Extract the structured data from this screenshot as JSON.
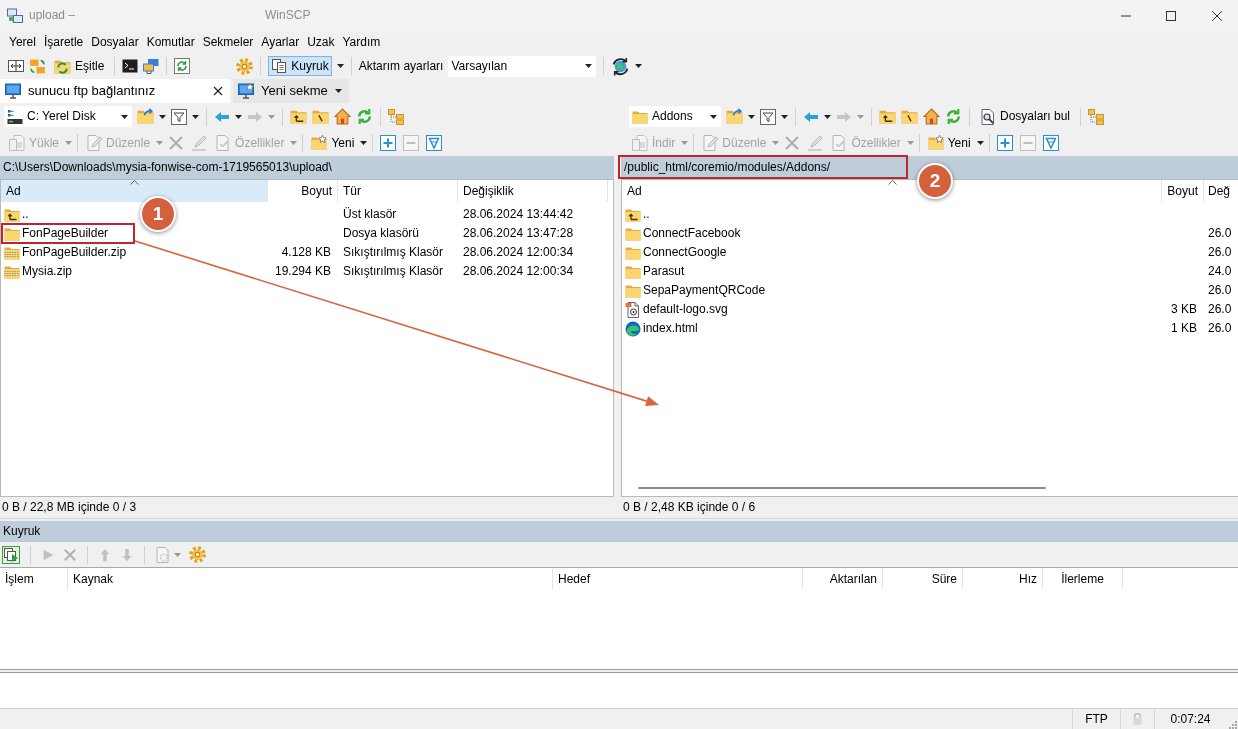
{
  "window": {
    "title": "upload –",
    "app_name": "WinSCP"
  },
  "menu": [
    "Yerel",
    "İşaretle",
    "Dosyalar",
    "Komutlar",
    "Sekmeler",
    "Ayarlar",
    "Uzak",
    "Yardım"
  ],
  "toolbar": {
    "sync_label": "Eşitle",
    "queue_button": {
      "label": "Kuyruk",
      "on": true
    },
    "transfer_settings_label": "Aktarım ayarları",
    "transfer_preset": "Varsayılan"
  },
  "tabs": [
    {
      "kind": "session",
      "label": "sunucu ftp bağlantınız",
      "selected": true
    },
    {
      "kind": "new",
      "label": "Yeni sekme",
      "selected": false
    }
  ],
  "local_panel": {
    "active": true,
    "location": {
      "kind": "drive",
      "label": "C: Yerel Disk"
    },
    "back_disabled": false,
    "forward_disabled": true,
    "commands": [
      {
        "kind": "transfer",
        "label": "Yükle",
        "disabled": true
      },
      {
        "kind": "edit",
        "label": "Düzenle",
        "disabled": true
      },
      {
        "kind": "delete",
        "disabled": true
      },
      {
        "kind": "rename",
        "disabled": true
      },
      {
        "kind": "properties",
        "label": "Özellikler",
        "disabled": true
      },
      {
        "kind": "new",
        "label": "Yeni",
        "disabled": false
      },
      {
        "kind": "select",
        "disabled": false
      },
      {
        "kind": "unselect",
        "disabled": true
      },
      {
        "kind": "filter",
        "disabled": false
      }
    ],
    "path": "C:\\Users\\Downloads\\mysia-fonwise-com-1719565013\\upload\\",
    "columns": [
      {
        "kind": "name",
        "label": "Ad",
        "sorted": true
      },
      {
        "kind": "size",
        "label": "Boyut",
        "sorted": false
      },
      {
        "kind": "type",
        "label": "Tür",
        "sorted": false
      },
      {
        "kind": "modified",
        "label": "Değişiklik",
        "sorted": false
      }
    ],
    "rows": [
      {
        "kind": "parent",
        "name": "..",
        "type": "Üst klasör",
        "modified": "28.06.2024 13:44:42"
      },
      {
        "kind": "folder",
        "name": "FonPageBuilder",
        "type": "Dosya klasörü",
        "modified": "28.06.2024 13:47:28",
        "callout": "1"
      },
      {
        "kind": "zip",
        "name": "FonPageBuilder.zip",
        "size": "4.128 KB",
        "type": "Sıkıştırılmış Klasör",
        "modified": "28.06.2024 12:00:34"
      },
      {
        "kind": "zip",
        "name": "Mysia.zip",
        "size": "19.294 KB",
        "type": "Sıkıştırılmış Klasör",
        "modified": "28.06.2024 12:00:34"
      }
    ],
    "status": "0 B / 22,8 MB içinde 0 / 3"
  },
  "remote_panel": {
    "active": false,
    "location": {
      "kind": "folder",
      "label": "Addons"
    },
    "back_disabled": false,
    "forward_disabled": true,
    "find_label": "Dosyaları bul",
    "commands": [
      {
        "kind": "transfer",
        "label": "İndir",
        "disabled": true
      },
      {
        "kind": "edit",
        "label": "Düzenle",
        "disabled": true
      },
      {
        "kind": "delete",
        "disabled": true
      },
      {
        "kind": "rename",
        "disabled": true
      },
      {
        "kind": "properties",
        "label": "Özellikler",
        "disabled": true
      },
      {
        "kind": "new",
        "label": "Yeni",
        "disabled": false
      },
      {
        "kind": "select",
        "disabled": false
      },
      {
        "kind": "unselect",
        "disabled": true
      },
      {
        "kind": "filter",
        "disabled": false
      }
    ],
    "path": "/public_html/coremio/modules/Addons/",
    "path_callout": "2",
    "columns": [
      {
        "kind": "name",
        "label": "Ad",
        "sorted": true
      },
      {
        "kind": "size",
        "label": "Boyut",
        "sorted": false
      },
      {
        "kind": "modified",
        "label": "Değ",
        "sorted": false
      }
    ],
    "rows": [
      {
        "kind": "parent",
        "name": ".."
      },
      {
        "kind": "folder",
        "name": "ConnectFacebook",
        "modified": "26.0"
      },
      {
        "kind": "folder",
        "name": "ConnectGoogle",
        "modified": "26.0"
      },
      {
        "kind": "folder",
        "name": "Parasut",
        "modified": "24.0"
      },
      {
        "kind": "folder",
        "name": "SepaPaymentQRCode",
        "modified": "26.0"
      },
      {
        "kind": "svg",
        "name": "default-logo.svg",
        "size": "3 KB",
        "modified": "26.0"
      },
      {
        "kind": "html",
        "name": "index.html",
        "size": "1 KB",
        "modified": "26.0"
      }
    ],
    "status": "0 B / 2,48 KB içinde 0 / 6"
  },
  "queue": {
    "title": "Kuyruk",
    "tools": [
      {
        "kind": "queue",
        "disabled": false
      },
      {
        "kind": "run",
        "disabled": true
      },
      {
        "kind": "cancel",
        "disabled": true
      },
      {
        "kind": "up",
        "disabled": true
      },
      {
        "kind": "down",
        "disabled": true
      },
      {
        "kind": "action",
        "disabled": true
      },
      {
        "kind": "settings",
        "disabled": false
      }
    ],
    "columns": [
      "İşlem",
      "Kaynak",
      "Hedef",
      "Aktarılan",
      "Süre",
      "Hız",
      "İlerleme"
    ]
  },
  "status_bar": {
    "protocol": "FTP",
    "encrypted": false,
    "elapsed": "0:07:24"
  }
}
